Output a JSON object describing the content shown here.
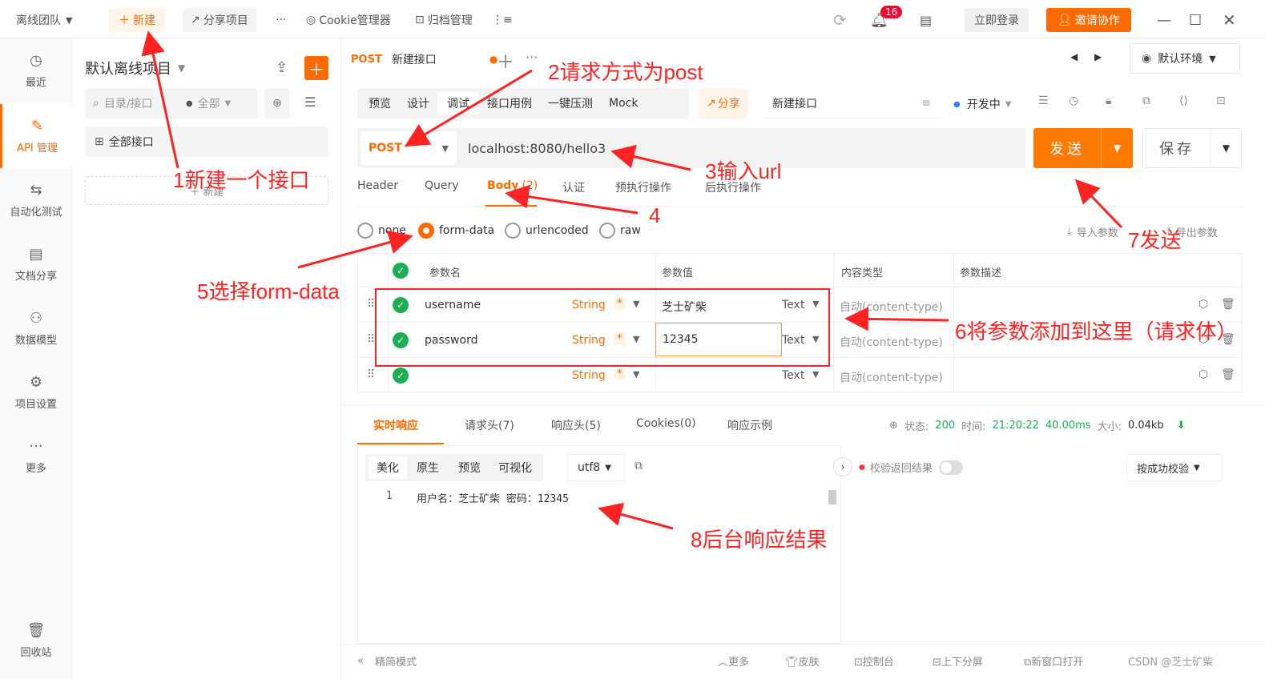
{
  "topbar": {
    "team": "离线团队",
    "new_label": "新建",
    "share_label": "分享项目",
    "more": "···",
    "cookie_label": "Cookie管理器",
    "archive_label": "归档管理",
    "badge_count": "16",
    "login_label": "立即登录",
    "invite_label": "邀请协作"
  },
  "nav": {
    "items": [
      "最近",
      "API 管理",
      "自动化测试",
      "文档分享",
      "数据模型",
      "项目设置",
      "更多"
    ],
    "trash": "回收站"
  },
  "tree": {
    "project": "默认离线项目",
    "search_placeholder": "目录/接口",
    "filter": "全部",
    "all_apis": "全部接口",
    "new_label": "新建"
  },
  "tabs": {
    "method": "POST",
    "name": "新建接口",
    "env": "默认环境"
  },
  "modes": [
    "预览",
    "设计",
    "调试",
    "接口用例",
    "一键压测",
    "Mock"
  ],
  "share_label": "分享",
  "api_name": "新建接口",
  "status": "开发中",
  "request": {
    "method": "POST",
    "url": "localhost:8080/hello3",
    "send": "发送",
    "save": "保存"
  },
  "req_tabs": [
    "Header",
    "Query",
    "Body",
    "认证",
    "预执行操作",
    "后执行操作"
  ],
  "body_count": "(2)",
  "body_types": [
    "none",
    "form-data",
    "urlencoded",
    "raw"
  ],
  "import_label": "导入参数",
  "export_label": "导出参数",
  "table": {
    "headers": [
      "参数名",
      "参数值",
      "内容类型",
      "参数描述"
    ],
    "rows": [
      {
        "name": "username",
        "type": "String",
        "req": "*",
        "value": "芝士矿柴",
        "vtype": "Text",
        "ctype": "自动(content-type)"
      },
      {
        "name": "password",
        "type": "String",
        "req": "*",
        "value": "12345",
        "vtype": "Text",
        "ctype": "自动(content-type)"
      },
      {
        "name": "",
        "type": "String",
        "req": "*",
        "value": "",
        "vtype": "Text",
        "ctype": "自动(content-type)"
      }
    ]
  },
  "resp_tabs": [
    "实时响应",
    "请求头(7)",
    "响应头(5)",
    "Cookies(0)",
    "响应示例"
  ],
  "resp_status": {
    "status_label": "状态:",
    "status": "200",
    "time_label": "时间:",
    "time": "21:20:22",
    "duration": "40.00ms",
    "size_label": "大小:",
    "size": "0.04kb"
  },
  "view_modes": [
    "美化",
    "原生",
    "预览",
    "可视化"
  ],
  "encoding": "utf8",
  "verify_label": "校验返回结果",
  "verify_select": "按成功校验",
  "response": {
    "line": "1",
    "text": "用户名：芝士矿柴 密码：12345"
  },
  "bottom": {
    "simple": "精简模式",
    "items": [
      "更多",
      "皮肤",
      "控制台",
      "上下分屏",
      "新窗口打开"
    ],
    "watermark": "CSDN @芝士矿柴"
  },
  "annotations": {
    "a1": "1新建一个接口",
    "a2": "2请求方式为post",
    "a3": "3输入url",
    "a4": "4",
    "a5": "5选择form-data",
    "a6": "6将参数添加到这里（请求体）",
    "a7": "7发送",
    "a8": "8后台响应结果"
  },
  "colors": {
    "accent": "#ff6a00",
    "annotation": "#ff2222",
    "success": "#1cae55"
  }
}
